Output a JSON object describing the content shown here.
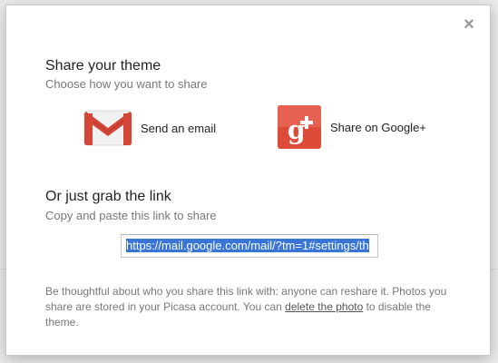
{
  "dialog": {
    "close_glyph": "×",
    "share_theme": {
      "title": "Share your theme",
      "subtitle": "Choose how you want to share"
    },
    "options": [
      {
        "label": "Send an email",
        "icon": "gmail-icon"
      },
      {
        "label": "Share on Google+",
        "icon": "google-plus-icon"
      }
    ],
    "grab_link": {
      "title": "Or just grab the link",
      "subtitle": "Copy and paste this link to share",
      "value": "https://mail.google.com/mail/?tm=1#settings/th"
    },
    "note": {
      "before": "Be thoughtful about who you share this link with: anyone can reshare it. Photos you share are stored in your Picasa account. You can ",
      "link": "delete the photo",
      "after": " to disable the theme."
    }
  },
  "colors": {
    "gmail_red": "#d44638",
    "google_plus_red": "#dd4b39",
    "selection_blue": "#3875d7"
  }
}
